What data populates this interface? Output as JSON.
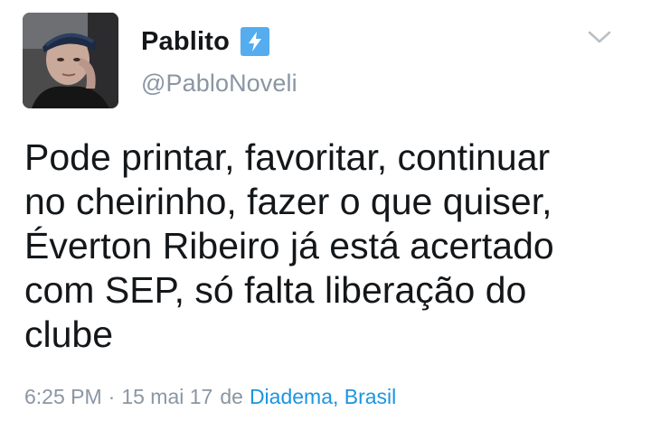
{
  "user": {
    "display_name": "Pablito",
    "handle": "@PabloNoveli",
    "badge_icon": "lightning-bolt-icon",
    "avatar_icon": "profile-photo"
  },
  "tweet": {
    "text": "Pode printar, favoritar, continuar\nno cheirinho, fazer o que quiser,\nÉverton Ribeiro já está acertado\ncom SEP, só falta liberação do\nclube"
  },
  "meta": {
    "time": "6:25 PM",
    "separator": "·",
    "date": "15 mai 17",
    "from_label": "de",
    "location": "Diadema, Brasil"
  },
  "menu": {
    "caret_icon": "chevron-down-icon"
  },
  "colors": {
    "text": "#14171a",
    "muted": "#8a96a3",
    "link": "#1b95e0",
    "badge": "#55acee"
  }
}
